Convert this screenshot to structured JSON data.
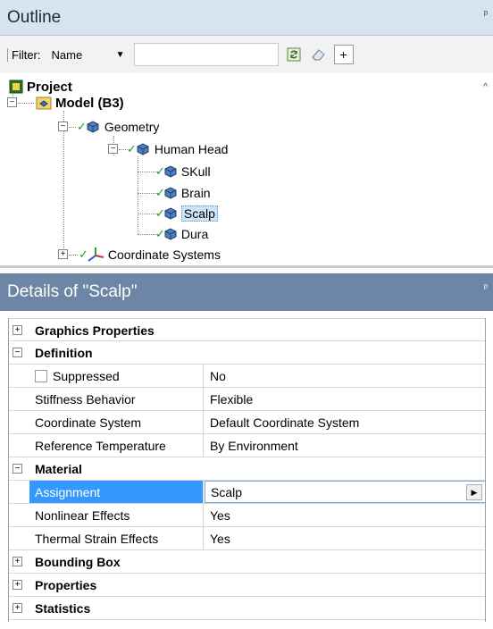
{
  "outline": {
    "title": "Outline",
    "filter_label": "Filter:",
    "filter_select": "Name",
    "filter_value": "",
    "tree": {
      "project": "Project",
      "model": "Model (B3)",
      "geometry": "Geometry",
      "human_head": "Human Head",
      "skull": "SKull",
      "brain": "Brain",
      "scalp": "Scalp",
      "dura": "Dura",
      "coordinate_systems": "Coordinate Systems"
    }
  },
  "details": {
    "title": "Details of \"Scalp\"",
    "groups": {
      "graphics": "Graphics Properties",
      "definition": "Definition",
      "material": "Material",
      "bounding_box": "Bounding Box",
      "properties": "Properties",
      "statistics": "Statistics"
    },
    "definition": {
      "suppressed_label": "Suppressed",
      "suppressed_value": "No",
      "stiffness_label": "Stiffness Behavior",
      "stiffness_value": "Flexible",
      "coord_label": "Coordinate System",
      "coord_value": "Default Coordinate System",
      "reftemp_label": "Reference Temperature",
      "reftemp_value": "By Environment"
    },
    "material": {
      "assignment_label": "Assignment",
      "assignment_value": "Scalp",
      "nonlinear_label": "Nonlinear Effects",
      "nonlinear_value": "Yes",
      "thermal_label": "Thermal Strain Effects",
      "thermal_value": "Yes"
    }
  },
  "colors": {
    "outline_header": "#d8e3f1",
    "details_header": "#6e86a5",
    "selection": "#3399ff",
    "check": "#1f9b2e"
  }
}
